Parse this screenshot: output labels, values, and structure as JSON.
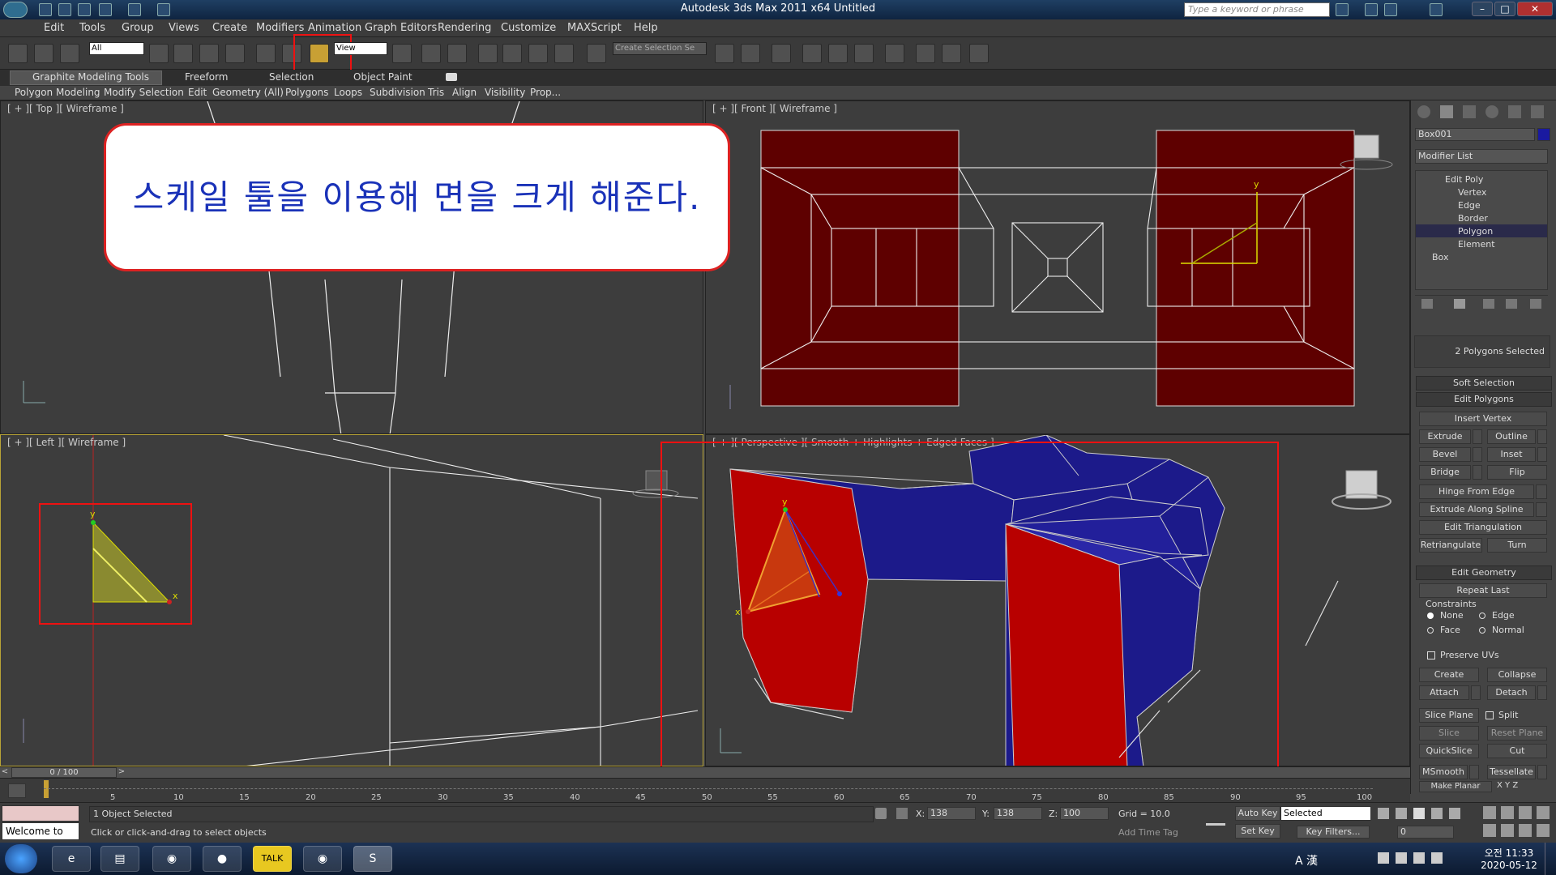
{
  "window": {
    "title": "Autodesk 3ds Max  2011 x64     Untitled",
    "search_placeholder": "Type a keyword or phrase"
  },
  "menu": [
    "Edit",
    "Tools",
    "Group",
    "Views",
    "Create",
    "Modifiers",
    "Animation",
    "Graph Editors",
    "Rendering",
    "Customize",
    "MAXScript",
    "Help"
  ],
  "toolbar": {
    "filter_value": "All",
    "refcoord_value": "View",
    "selection_set_placeholder": "Create Selection Se"
  },
  "ribbon": {
    "tabs": [
      "Graphite Modeling Tools",
      "Freeform",
      "Selection",
      "Object Paint"
    ],
    "panels": [
      "Polygon Modeling",
      "Modify Selection",
      "Edit",
      "Geometry (All)",
      "Polygons",
      "Loops",
      "Subdivision",
      "Tris",
      "Align",
      "Visibility",
      "Prop..."
    ]
  },
  "viewports": {
    "top": "[ + ][ Top ][ Wireframe ]",
    "front": "[ + ][ Front ][ Wireframe ]",
    "left": "[ + ][ Left ][ Wireframe ]",
    "perspective": "[ + ][ Perspective ][ Smooth + Highlights + Edged Faces ]"
  },
  "callout": {
    "text": "스케일 툴을 이용해 면을 크게 해준다."
  },
  "command_panel": {
    "object_name": "Box001",
    "modifier_list": "Modifier List",
    "stack": [
      "Edit Poly",
      "Vertex",
      "Edge",
      "Border",
      "Polygon",
      "Element",
      "Box"
    ],
    "selection_info": "2 Polygons Selected",
    "soft_selection": "Soft Selection",
    "edit_polygons": "Edit Polygons",
    "insert_vertex": "Insert Vertex",
    "extrude": "Extrude",
    "outline": "Outline",
    "bevel": "Bevel",
    "inset": "Inset",
    "bridge": "Bridge",
    "flip": "Flip",
    "hinge": "Hinge From Edge",
    "extrude_spline": "Extrude Along Spline",
    "edit_triangulation": "Edit Triangulation",
    "retriangulate": "Retriangulate",
    "turn": "Turn",
    "edit_geometry": "Edit Geometry",
    "repeat_last": "Repeat Last",
    "constraints": "Constraints",
    "c_none": "None",
    "c_edge": "Edge",
    "c_face": "Face",
    "c_normal": "Normal",
    "preserve_uvs": "Preserve UVs",
    "create": "Create",
    "collapse": "Collapse",
    "attach": "Attach",
    "detach": "Detach",
    "slice_plane": "Slice Plane",
    "split": "Split",
    "slice": "Slice",
    "reset_plane": "Reset Plane",
    "quickslice": "QuickSlice",
    "cut": "Cut",
    "msmooth": "MSmooth",
    "tessellate": "Tessellate",
    "make_planar": "Make Planar",
    "xyz": "X  Y  Z"
  },
  "timeline": {
    "frame": "0 / 100",
    "ticks": [
      "5",
      "10",
      "15",
      "20",
      "25",
      "30",
      "35",
      "40",
      "45",
      "50",
      "55",
      "60",
      "65",
      "70",
      "75",
      "80",
      "85",
      "90",
      "95",
      "100"
    ]
  },
  "status": {
    "welcome": "Welcome to MA",
    "selected": "1 Object Selected",
    "prompt": "Click or click-and-drag to select objects",
    "x_label": "X:",
    "x_value": "138",
    "y_label": "Y:",
    "y_value": "138",
    "z_label": "Z:",
    "z_value": "100",
    "grid": "Grid = 10.0",
    "autokey": "Auto Key",
    "setkey": "Set Key",
    "selected_dd": "Selected",
    "key_filters": "Key Filters...",
    "add_time_tag": "Add Time Tag",
    "frame_value": "0"
  },
  "taskbar": {
    "time": "오전 11:33",
    "date": "2020-05-12",
    "lang": "A 漢"
  },
  "colors": {
    "selected_face": "#b80000",
    "mesh_blue": "#1c1a8a",
    "highlight_red": "#e11111",
    "callout_text": "#1a32b8"
  }
}
